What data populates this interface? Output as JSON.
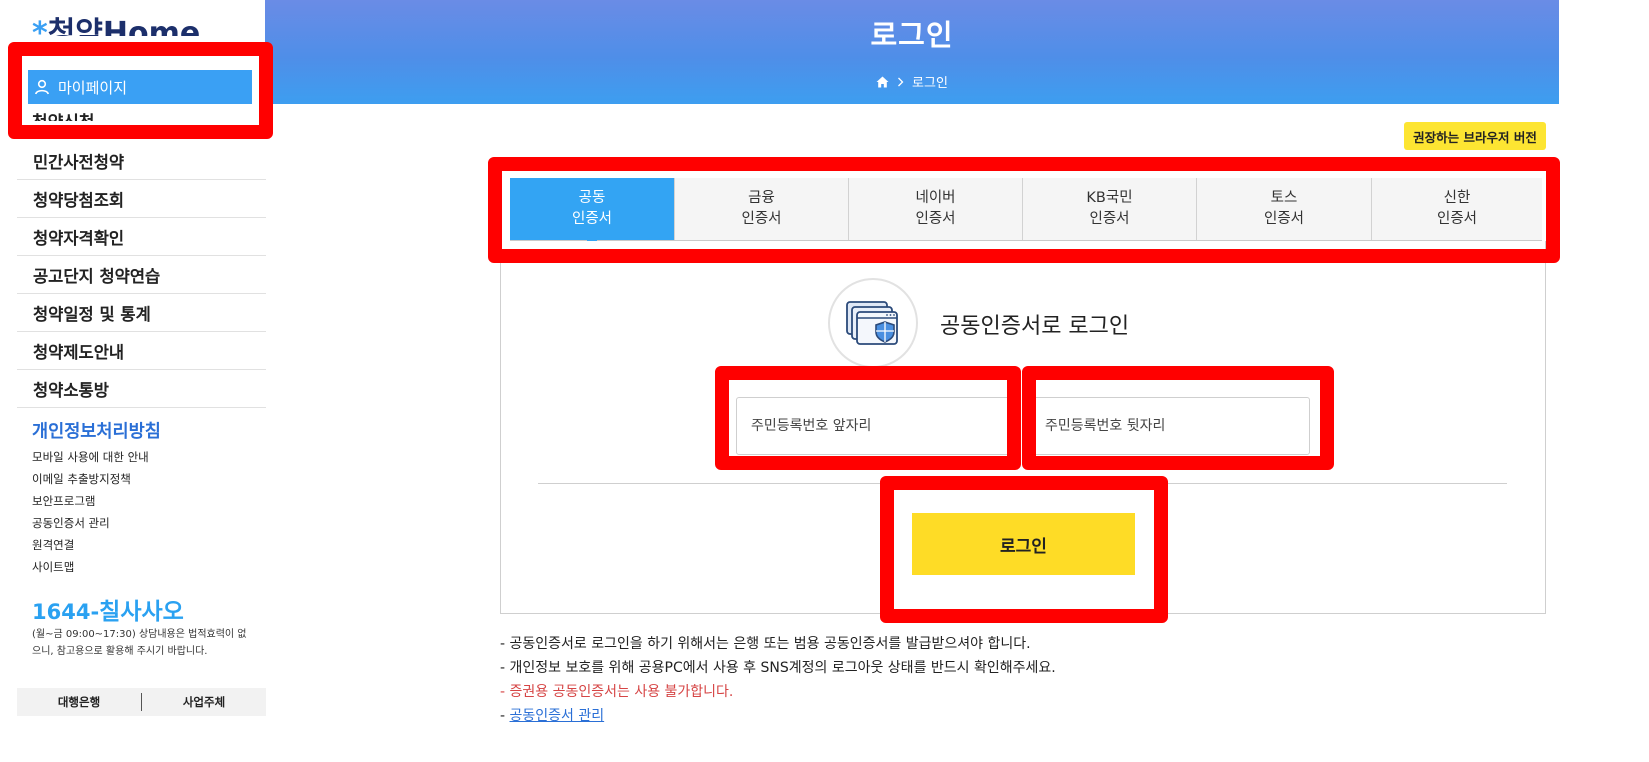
{
  "header": {
    "title": "로그인",
    "breadcrumb_current": "로그인"
  },
  "sidebar": {
    "logo_text": "청약Home",
    "mypage_label": "마이페이지",
    "clipped_item": "청약신청",
    "nav_items": [
      "민간사전청약",
      "청약당첨조회",
      "청약자격확인",
      "공고단지 청약연습",
      "청약일정 및 통계",
      "청약제도안내",
      "청약소통방"
    ],
    "privacy_label": "개인정보처리방침",
    "sub_links": [
      "모바일 사용에 대한 안내",
      "이메일 추출방지정책",
      "보안프로그램",
      "공동인증서 관리",
      "원격연결",
      "사이트맵"
    ],
    "phone_prefix": "1644-",
    "phone_name": "칠사사오",
    "hours_text": "(월~금 09:00~17:30) 상담내용은 법적효력이 없으니, 참고용으로 활용해 주시기 바랍니다.",
    "bottom_tabs": [
      "대행은행",
      "사업주체"
    ]
  },
  "recommend_label": "권장하는 브라우저 버전",
  "tabs": [
    {
      "line1": "공동",
      "line2": "인증서",
      "active": true
    },
    {
      "line1": "금융",
      "line2": "인증서",
      "active": false
    },
    {
      "line1": "네이버",
      "line2": "인증서",
      "active": false
    },
    {
      "line1": "KB국민",
      "line2": "인증서",
      "active": false
    },
    {
      "line1": "토스",
      "line2": "인증서",
      "active": false
    },
    {
      "line1": "신한",
      "line2": "인증서",
      "active": false
    }
  ],
  "login": {
    "title": "공동인증서로 로그인",
    "front_placeholder": "주민등록번호 앞자리",
    "back_placeholder": "주민등록번호 뒷자리",
    "button_label": "로그인"
  },
  "notes": {
    "line1": "- 공동인증서로 로그인을 하기 위해서는 은행 또는 범용 공동인증서를 발급받으셔야 합니다.",
    "line2": "- 개인정보 보호를 위해 공용PC에서 사용 후 SNS계정의 로그아웃 상태를 반드시 확인해주세요.",
    "line3": "- 증권용 공동인증서는 사용 불가합니다.",
    "line4_prefix": "- ",
    "line4_link": "공동인증서 관리"
  },
  "colors": {
    "accent_blue": "#33a4f3",
    "login_yellow": "#fedc26",
    "annotation_red": "#ff0000"
  }
}
